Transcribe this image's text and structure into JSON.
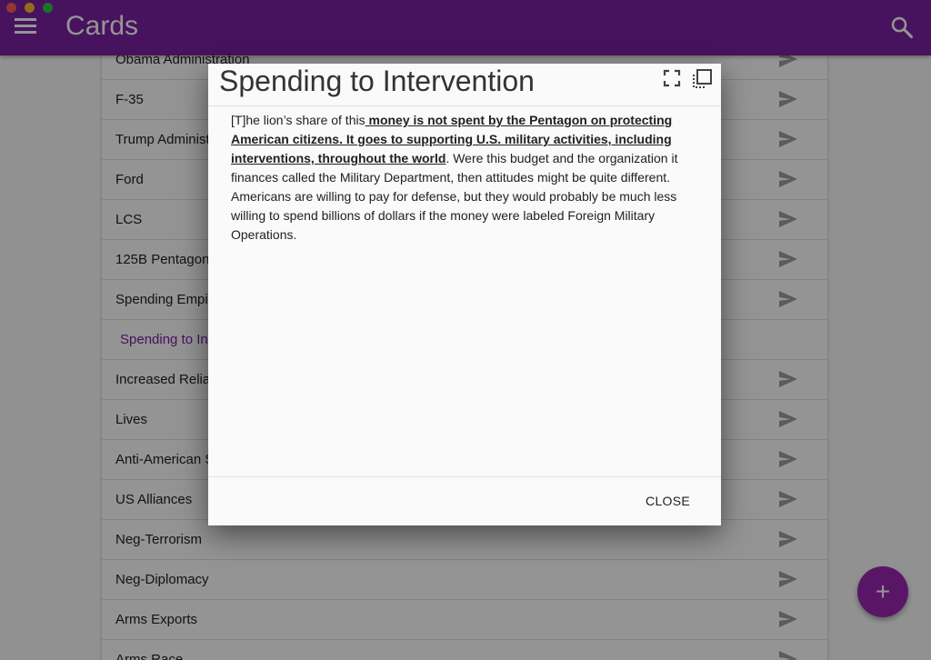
{
  "window": {
    "traffic_lights": [
      "close",
      "minimize",
      "zoom"
    ]
  },
  "toolbar": {
    "title": "Cards",
    "menu_icon": "hamburger-menu-icon",
    "search_icon": "search-icon",
    "color": "#7b1fa2"
  },
  "list": {
    "items": [
      {
        "label": "Obama Administration",
        "active": false
      },
      {
        "label": "F-35",
        "active": false
      },
      {
        "label": "Trump Administ",
        "active": false
      },
      {
        "label": "Ford",
        "active": false
      },
      {
        "label": "LCS",
        "active": false
      },
      {
        "label": "125B Pentagon",
        "active": false
      },
      {
        "label": "Spending Empir",
        "active": false
      },
      {
        "label": "Spending to Int",
        "active": true
      },
      {
        "label": "Increased Relian",
        "active": false
      },
      {
        "label": "Lives",
        "active": false
      },
      {
        "label": "Anti-American S",
        "active": false
      },
      {
        "label": "US Alliances",
        "active": false
      },
      {
        "label": "Neg-Terrorism",
        "active": false
      },
      {
        "label": "Neg-Diplomacy",
        "active": false
      },
      {
        "label": "Arms Exports",
        "active": false
      },
      {
        "label": "Arms Race",
        "active": false
      }
    ],
    "action_icon": "send-icon"
  },
  "fab": {
    "label": "+",
    "color": "#9c27b0"
  },
  "dialog": {
    "title": "Spending to Intervention",
    "fullscreen_icon": "fullscreen-icon",
    "copy_icon": "copy-icon",
    "body_pre": "[T]he lion’s share of this",
    "body_emph": " money is not spent by the Pentagon on protecting American citizens. It goes to supporting U.S. military activities, including interventions, throughout the world",
    "body_post": ". Were this budget and the organization it finances called the Military Department, then attitudes might be quite different. Americans are willing to pay for defense, but they would probably be much less willing to spend billions of dollars if the money were labeled Foreign Military Operations.",
    "close_label": "CLOSE"
  }
}
